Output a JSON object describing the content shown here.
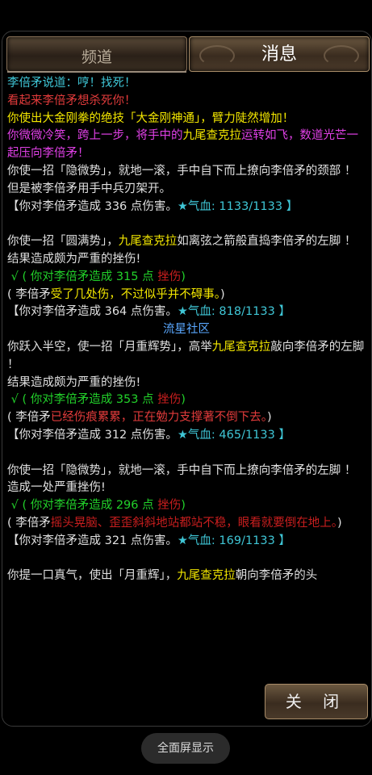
{
  "tabs": {
    "channel": "频道",
    "messages": "消息"
  },
  "buttons": {
    "close": "关 闭",
    "fullscreen": "全面屏显示"
  },
  "log": [
    [
      {
        "t": "李倍矛说道：哼！找死！",
        "c": "c-cyan"
      }
    ],
    [
      {
        "t": "看起来李倍矛想杀死你！",
        "c": "c-red"
      }
    ],
    [
      {
        "t": "你使出大金刚拳的绝技「大金刚神通」，臂力陡然增加！",
        "c": "c-yel"
      }
    ],
    [
      {
        "t": "你微微冷笑，跨上一步，将手中的",
        "c": "c-mag"
      },
      {
        "t": "九尾查克拉",
        "c": "c-yel"
      },
      {
        "t": "运转如飞，数道光芒一起压向李倍矛！",
        "c": "c-mag"
      }
    ],
    [
      {
        "t": "你使一招「隐微势」，就地一滚，手中自下而上撩向李倍矛的颈部 ！",
        "c": "c-wht"
      }
    ],
    [
      {
        "t": "但是被李倍矛用手中兵刃架开。",
        "c": "c-wht"
      }
    ],
    [
      {
        "t": "【你对李倍矛造成 336 点伤害。",
        "c": "c-wht"
      },
      {
        "t": "★气血: 1133/1133 】",
        "c": "c-star"
      }
    ],
    [],
    [
      {
        "t": "你使一招「圆满势」，",
        "c": "c-wht"
      },
      {
        "t": "九尾查克拉",
        "c": "c-yel"
      },
      {
        "t": "如离弦之箭般直捣李倍矛的左脚 ！",
        "c": "c-wht"
      }
    ],
    [
      {
        "t": "结果造成颇为严重的挫伤!",
        "c": "c-wht"
      }
    ],
    [
      {
        "t": " √ ( 你对李倍矛造成 315 点 ",
        "c": "c-grn"
      },
      {
        "t": "挫伤",
        "c": "c-dred"
      },
      {
        "t": ")",
        "c": "c-grn"
      }
    ],
    [
      {
        "t": "( 李倍矛",
        "c": "c-wht"
      },
      {
        "t": "受了几处伤，不过似乎并不碍事。",
        "c": "c-yel"
      },
      {
        "t": ")",
        "c": "c-wht"
      }
    ],
    [
      {
        "t": "【你对李倍矛造成 364 点伤害。",
        "c": "c-wht"
      },
      {
        "t": "★气血: 818/1133 】",
        "c": "c-star"
      }
    ],
    [
      {
        "t": "流星社区",
        "c": "c-blu center"
      }
    ],
    [
      {
        "t": "你跃入半空，使一招「月重辉势」，高举",
        "c": "c-wht"
      },
      {
        "t": "九尾查克拉",
        "c": "c-yel"
      },
      {
        "t": "敲向李倍矛的左脚 ！",
        "c": "c-wht"
      }
    ],
    [
      {
        "t": "结果造成颇为严重的挫伤!",
        "c": "c-wht"
      }
    ],
    [
      {
        "t": " √ ( 你对李倍矛造成 353 点 ",
        "c": "c-grn"
      },
      {
        "t": "挫伤",
        "c": "c-dred"
      },
      {
        "t": ")",
        "c": "c-grn"
      }
    ],
    [
      {
        "t": "( 李倍矛",
        "c": "c-wht"
      },
      {
        "t": "已经伤痕累累，正在勉力支撑著不倒下去。",
        "c": "c-red"
      },
      {
        "t": ")",
        "c": "c-wht"
      }
    ],
    [
      {
        "t": "【你对李倍矛造成 312 点伤害。",
        "c": "c-wht"
      },
      {
        "t": "★气血: 465/1133 】",
        "c": "c-star"
      }
    ],
    [],
    [
      {
        "t": "你使一招「隐微势」，就地一滚，手中自下而上撩向李倍矛的左脚 ！",
        "c": "c-wht"
      }
    ],
    [
      {
        "t": "造成一处严重挫伤!",
        "c": "c-wht"
      }
    ],
    [
      {
        "t": " √ ( 你对李倍矛造成 296 点 ",
        "c": "c-grn"
      },
      {
        "t": "挫伤",
        "c": "c-dred"
      },
      {
        "t": ")",
        "c": "c-grn"
      }
    ],
    [
      {
        "t": "( 李倍矛",
        "c": "c-wht"
      },
      {
        "t": "摇头晃脑、歪歪斜斜地站都站不稳，眼看就要倒在地上。",
        "c": "c-dred"
      },
      {
        "t": ")",
        "c": "c-wht"
      }
    ],
    [
      {
        "t": "【你对李倍矛造成 321 点伤害。",
        "c": "c-wht"
      },
      {
        "t": "★气血: 169/1133 】",
        "c": "c-star"
      }
    ],
    [],
    [
      {
        "t": "你提一口真气，使出「月重辉」，",
        "c": "c-wht"
      },
      {
        "t": "九尾查克拉",
        "c": "c-yel"
      },
      {
        "t": "朝向李倍矛的头",
        "c": "c-wht"
      }
    ]
  ]
}
